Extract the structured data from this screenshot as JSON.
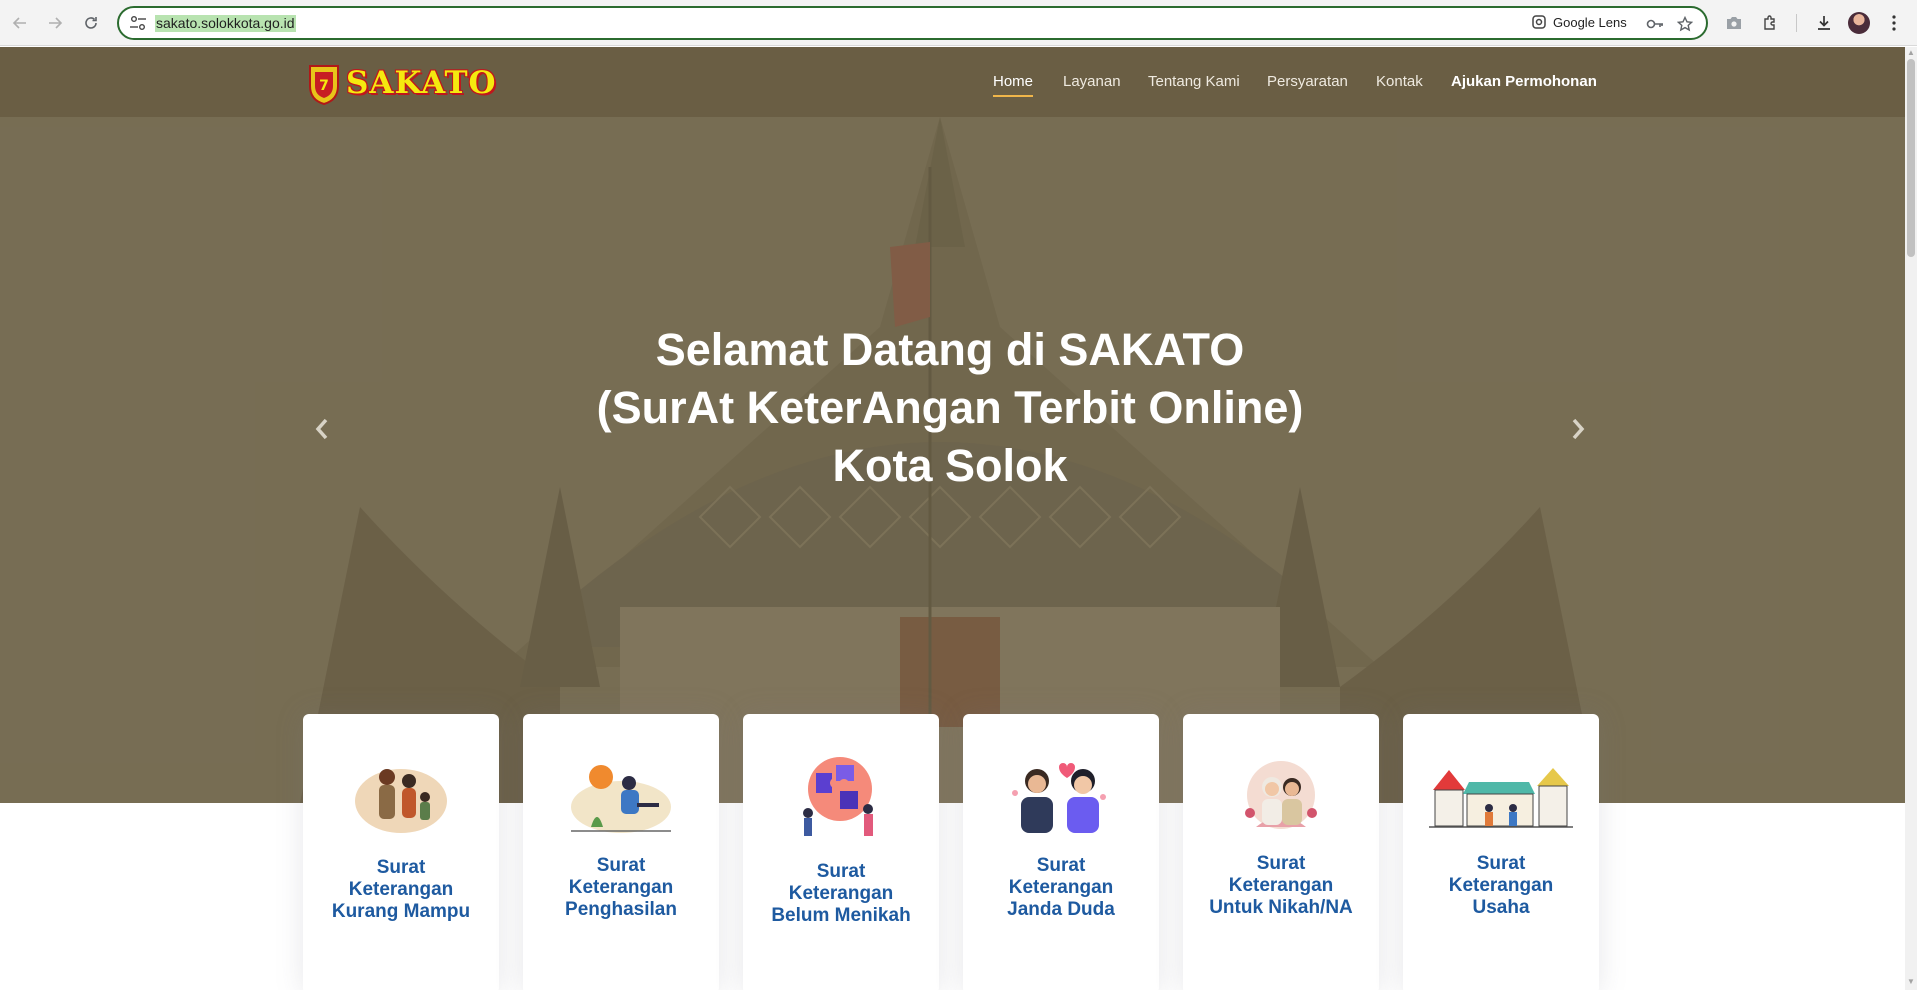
{
  "browser": {
    "url": "sakato.solokkota.go.id",
    "lens_label": "Google Lens"
  },
  "site": {
    "logo_text": "SAKATO",
    "nav": [
      {
        "label": "Home"
      },
      {
        "label": "Layanan"
      },
      {
        "label": "Tentang Kami"
      },
      {
        "label": "Persyaratan"
      },
      {
        "label": "Kontak"
      },
      {
        "label": "Ajukan Permohonan"
      }
    ],
    "hero": {
      "line1": "Selamat Datang di SAKATO",
      "line2": "(SurAt KeterAngan Terbit Online)",
      "line3": "Kota Solok"
    },
    "cards": [
      {
        "title": "Surat Keterangan Kurang Mampu"
      },
      {
        "title": "Surat Keterangan Penghasilan"
      },
      {
        "title": "Surat Keterangan Belum Menikah"
      },
      {
        "title": "Surat Keterangan Janda Duda"
      },
      {
        "title": "Surat Keterangan Untuk Nikah/NA"
      },
      {
        "title": "Surat Keterangan Usaha"
      }
    ]
  },
  "colors": {
    "accent_underline": "#f0b64a",
    "card_title": "#1e5aa0",
    "omnibox_border": "#2b6b2f"
  }
}
